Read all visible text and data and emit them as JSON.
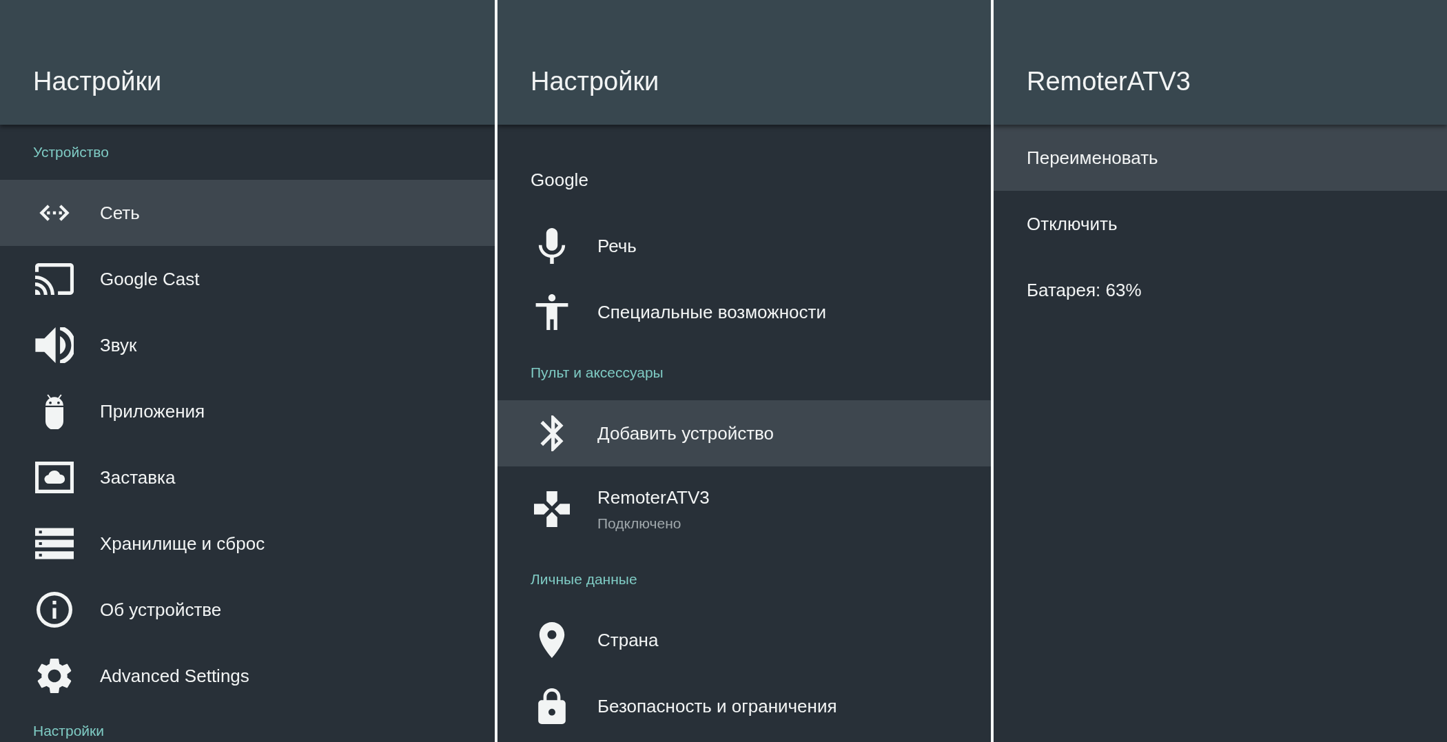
{
  "panels": [
    {
      "title": "Настройки",
      "items": [
        {
          "kind": "category",
          "label": "Устройство"
        },
        {
          "kind": "item",
          "label": "Сеть",
          "selected": true
        },
        {
          "kind": "item",
          "label": "Google Cast",
          "selected": false
        },
        {
          "kind": "item",
          "label": "Звук",
          "selected": false
        },
        {
          "kind": "item",
          "label": "Приложения",
          "selected": false
        },
        {
          "kind": "item",
          "label": "Заставка",
          "selected": false
        },
        {
          "kind": "item",
          "label": "Хранилище и сброс",
          "selected": false
        },
        {
          "kind": "item",
          "label": "Об устройстве",
          "selected": false
        },
        {
          "kind": "item",
          "label": "Advanced Settings",
          "selected": false
        },
        {
          "kind": "category",
          "label": "Настройки"
        }
      ]
    },
    {
      "title": "Настройки",
      "items": [
        {
          "kind": "item",
          "label": "Google",
          "selected": false
        },
        {
          "kind": "item",
          "label": "Речь",
          "selected": false
        },
        {
          "kind": "item",
          "label": "Специальные возможности",
          "selected": false
        },
        {
          "kind": "category",
          "label": "Пульт и аксессуары"
        },
        {
          "kind": "item",
          "label": "Добавить устройство",
          "selected": true
        },
        {
          "kind": "item",
          "label": "RemoterATV3",
          "subtitle": "Подключено",
          "selected": false
        },
        {
          "kind": "category",
          "label": "Личные данные"
        },
        {
          "kind": "item",
          "label": "Страна",
          "selected": false
        },
        {
          "kind": "item",
          "label": "Безопасность и ограничения",
          "selected": false
        }
      ]
    },
    {
      "title": "RemoterATV3",
      "items": [
        {
          "kind": "item",
          "label": "Переименовать",
          "selected": true
        },
        {
          "kind": "item",
          "label": "Отключить",
          "selected": false
        },
        {
          "kind": "item",
          "label": "Батарея: 63%",
          "selected": false
        }
      ]
    }
  ]
}
